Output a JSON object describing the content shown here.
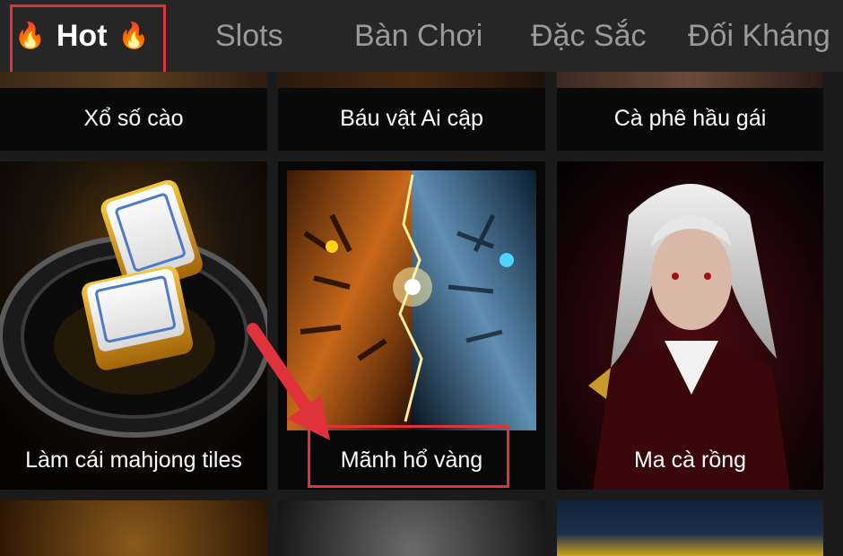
{
  "tabs": [
    {
      "label": "Hot",
      "active": true,
      "icon": "fire-icon"
    },
    {
      "label": "Slots",
      "active": false
    },
    {
      "label": "Bàn Chơi",
      "active": false
    },
    {
      "label": "Đặc Sắc",
      "active": false
    },
    {
      "label": "Đối Kháng",
      "active": false
    }
  ],
  "games": [
    {
      "name": "Xổ số cào"
    },
    {
      "name": "Báu vật Ai cập"
    },
    {
      "name": "Cà phê hầu gái"
    },
    {
      "name": "Làm cái mahjong tiles"
    },
    {
      "name": "Mãnh hổ vàng"
    },
    {
      "name": "Ma cà rồng"
    }
  ],
  "colors": {
    "highlight": "#e0323a",
    "tab_bar": "#262626",
    "page_bg": "#1b1b1b"
  }
}
